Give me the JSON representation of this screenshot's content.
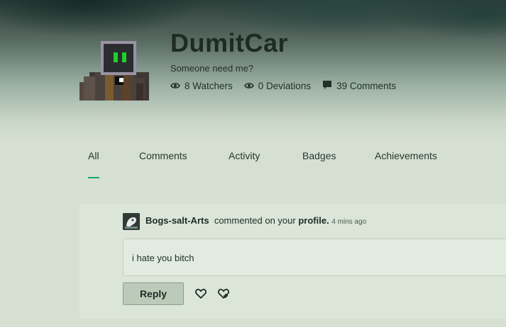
{
  "profile": {
    "username": "DumitCar",
    "tagline": "Someone need me?",
    "stats": {
      "watchers": "8 Watchers",
      "deviations": "0 Deviations",
      "comments": "39 Comments"
    }
  },
  "tabs": [
    {
      "label": "All",
      "active": true
    },
    {
      "label": "Comments"
    },
    {
      "label": "Activity"
    },
    {
      "label": "Badges"
    },
    {
      "label": "Achievements"
    }
  ],
  "activity": {
    "author": "Bogs-salt-Arts",
    "action": "commented on your",
    "target": "profile.",
    "time": "4 mins ago",
    "comment_text": "i hate you bitch",
    "reply_label": "Reply"
  },
  "colors": {
    "accent": "#12a96e",
    "text": "#22302a"
  },
  "icons": [
    "eye-icon",
    "speech-bubble-icon",
    "heart-icon",
    "heart-plus-icon"
  ]
}
